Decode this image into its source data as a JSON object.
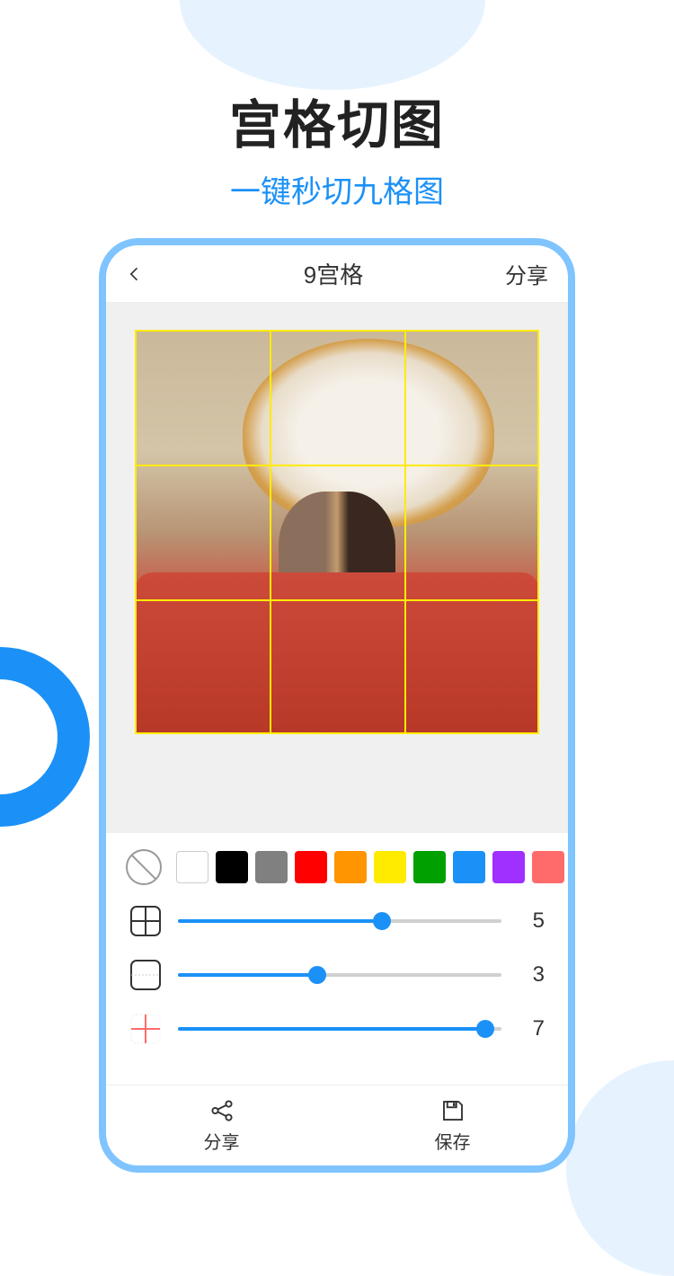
{
  "title": {
    "main": "宫格切图",
    "sub": "一键秒切九格图"
  },
  "nav": {
    "title": "9宫格",
    "share": "分享"
  },
  "colors": {
    "swatches": [
      "#ffffff",
      "#000000",
      "#808080",
      "#ff0000",
      "#ff9500",
      "#ffeb00",
      "#00a000",
      "#1b91f7",
      "#a030ff",
      "#ff6b6b"
    ]
  },
  "sliders": {
    "grid": {
      "value": 5,
      "max": 7,
      "fill_pct": 63
    },
    "border": {
      "value": 3,
      "max": 7,
      "fill_pct": 43
    },
    "gap": {
      "value": 7,
      "max": 7,
      "fill_pct": 95
    }
  },
  "bottom": {
    "share": "分享",
    "save": "保存"
  }
}
